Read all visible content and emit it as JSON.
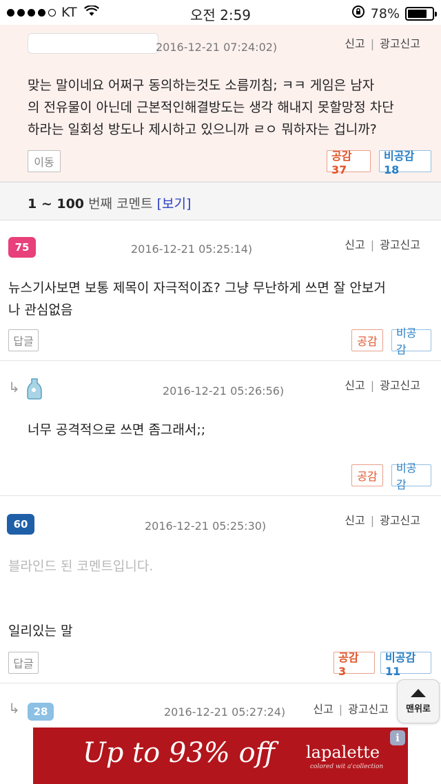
{
  "status_bar": {
    "carrier": "KT",
    "time": "오전 2:59",
    "battery": "78%",
    "battery_level": 0.78
  },
  "report": {
    "report_label": "신고",
    "ad_report_label": "광고신고"
  },
  "comments": [
    {
      "timestamp": "2016-12-21 07:24:02)",
      "text_lines": [
        "맞는 말이네요 어쩌구 동의하는것도 소름끼침; ㅋㅋ 게임은 남자",
        "의 전유물이 아닌데 근본적인해결방도는 생각 해내지 못할망정 차단",
        "하라는 일회성 방도나 제시하고 있으니까 ㄹㅇ 뭐하자는 겁니까?"
      ],
      "action_label": "이동",
      "like_label": "공감 37",
      "dislike_label": "비공감18"
    },
    {
      "level": "75",
      "level_color": "#e8407a",
      "timestamp": "2016-12-21 05:25:14)",
      "text_lines": [
        "뉴스기사보면 보통 제목이 자극적이죠? 그냥 무난하게 쓰면 잘 안보거",
        "나 관심없음"
      ],
      "action_label": "답글",
      "like_label": "공감",
      "dislike_label": "비공감"
    },
    {
      "timestamp": "2016-12-21 05:26:56)",
      "text_lines": [
        "너무 공격적으로 쓰면 좀그래서;;"
      ],
      "like_label": "공감",
      "dislike_label": "비공감"
    },
    {
      "level": "60",
      "level_color": "#1f5fa8",
      "timestamp": "2016-12-21 05:25:30)",
      "blinded_text": "블라인드 된 코멘트입니다.",
      "text_lines": [
        "일리있는 말"
      ],
      "action_label": "답글",
      "like_label": "공감 3",
      "dislike_label": "비공감11"
    },
    {
      "level": "28",
      "level_color": "#8cc0e4",
      "timestamp": "2016-12-21 05:27:24)"
    }
  ],
  "comment_range": {
    "range": "1 ~ 100",
    "label": "번째 코멘트",
    "view_link": "[보기]"
  },
  "top_button": {
    "label": "맨위로"
  },
  "ad": {
    "headline": "Up to 93% off",
    "brand": "lapalette",
    "brand_sub": "colored wit a'collection",
    "info": "i"
  }
}
